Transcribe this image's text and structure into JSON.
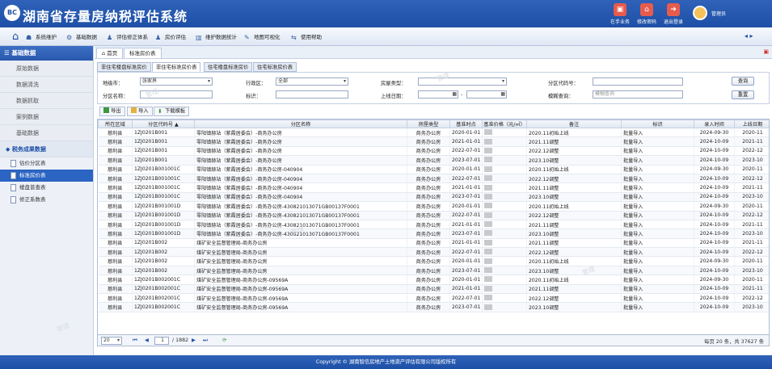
{
  "header": {
    "logo_text": "BC",
    "title": "湖南省存量房纳税评估系统",
    "buttons": [
      {
        "label": "在手业务",
        "icon": "briefcase-icon"
      },
      {
        "label": "修改密码",
        "icon": "lock-icon"
      },
      {
        "label": "退出登录",
        "icon": "logout-icon"
      }
    ],
    "user_name": "管理员"
  },
  "menu": [
    {
      "label": "系统维护",
      "icon": "users-icon"
    },
    {
      "label": "基础数据",
      "icon": "gear-icon"
    },
    {
      "label": "评估修正体系",
      "icon": "person-icon"
    },
    {
      "label": "房价评估",
      "icon": "person-icon"
    },
    {
      "label": "维护数据统计",
      "icon": "building-icon"
    },
    {
      "label": "地图可视化",
      "icon": "edit-icon"
    },
    {
      "label": "使用帮助",
      "icon": "help-icon"
    }
  ],
  "sidebar": {
    "title": "基础数据",
    "items": [
      "原始数据",
      "数据清洗",
      "数据抓取",
      "案例数据",
      "基础数据"
    ],
    "group": "税务成果数据",
    "subitems": [
      "估价分区表",
      "标准房价表",
      "楼盘普查表",
      "修正系数表"
    ]
  },
  "breadcrumb": {
    "home": "首页",
    "current": "标准房价表"
  },
  "subtabs": [
    "非住宅楼盘标准房价",
    "非住宅标准房价表",
    "住宅楼盘标准房价",
    "住宅标准房价表"
  ],
  "filters": {
    "city_label": "地级市：",
    "city_value": "张家界",
    "district_label": "行政区：",
    "district_value": "全部",
    "house_type_label": "房屋类型：",
    "house_type_value": "",
    "zone_code_label": "分区代码号：",
    "zone_code_value": "",
    "zone_name_label": "分区名称：",
    "zone_name_value": "",
    "mark_label": "标识：",
    "mark_value": "",
    "date_label": "上线日期：",
    "date_sep": "-",
    "fuzzy_label": "模糊查询：",
    "fuzzy_placeholder": "模糊查询",
    "search_button": "查询",
    "reset_button": "重置"
  },
  "toolbar": {
    "export": "导出",
    "import": "导入",
    "download": "下载模板"
  },
  "table": {
    "columns": [
      "所在区域",
      "分区代码号 ▲",
      "分区名称",
      "房屋类型",
      "基准时点",
      "基准价格（元/㎡）",
      "备注",
      "标识",
      "录入时间",
      "上线日期"
    ],
    "rows": [
      [
        "慈利县",
        "1ZJ0201B001",
        "零阳镇赫站（紫霞居委会）-商务办公房",
        "商务办公房",
        "2020-01-01",
        "",
        "2020.11初始上线",
        "批量导入",
        "2024-09-30",
        "2020-11"
      ],
      [
        "慈利县",
        "1ZJ0201B001",
        "零阳镇赫站（紫霞居委会）-商务办公房",
        "商务办公房",
        "2021-01-01",
        "",
        "2021.11调整",
        "批量导入",
        "2024-10-09",
        "2021-11"
      ],
      [
        "慈利县",
        "1ZJ0201B001",
        "零阳镇赫站（紫霞居委会）-商务办公房",
        "商务办公房",
        "2022-07-01",
        "",
        "2022.12调整",
        "批量导入",
        "2024-10-09",
        "2022-12"
      ],
      [
        "慈利县",
        "1ZJ0201B001",
        "零阳镇赫站（紫霞居委会）-商务办公房",
        "商务办公房",
        "2023-07-01",
        "",
        "2023.10调整",
        "批量导入",
        "2024-10-09",
        "2023-10"
      ],
      [
        "慈利县",
        "1ZJ0201B001001C",
        "零阳镇赫站（紫霞居委会）-商务办公房-040904",
        "商务办公房",
        "2020-01-01",
        "",
        "2020.11初始上线",
        "批量导入",
        "2024-09-30",
        "2020-11"
      ],
      [
        "慈利县",
        "1ZJ0201B001001C",
        "零阳镇赫站（紫霞居委会）-商务办公房-040904",
        "商务办公房",
        "2022-07-01",
        "",
        "2022.12调整",
        "批量导入",
        "2024-10-09",
        "2022-12"
      ],
      [
        "慈利县",
        "1ZJ0201B001001C",
        "零阳镇赫站（紫霞居委会）-商务办公房-040904",
        "商务办公房",
        "2021-01-01",
        "",
        "2021.11调整",
        "批量导入",
        "2024-10-09",
        "2021-11"
      ],
      [
        "慈利县",
        "1ZJ0201B001001C",
        "零阳镇赫站（紫霞居委会）-商务办公房-040904",
        "商务办公房",
        "2023-07-01",
        "",
        "2023.10调整",
        "批量导入",
        "2024-10-09",
        "2023-10"
      ],
      [
        "慈利县",
        "1ZJ0201B001001D",
        "零阳镇赫站（紫霞居委会）-商务办公房-430821013071GB00137F0001",
        "商务办公房",
        "2020-01-01",
        "",
        "2020.11初始上线",
        "批量导入",
        "2024-09-30",
        "2020-11"
      ],
      [
        "慈利县",
        "1ZJ0201B001001D",
        "零阳镇赫站（紫霞居委会）-商务办公房-430821013071GB00137F0001",
        "商务办公房",
        "2022-07-01",
        "",
        "2022.12调整",
        "批量导入",
        "2024-10-09",
        "2022-12"
      ],
      [
        "慈利县",
        "1ZJ0201B001001D",
        "零阳镇赫站（紫霞居委会）-商务办公房-430821013071GB00137F0001",
        "商务办公房",
        "2021-01-01",
        "",
        "2021.11调整",
        "批量导入",
        "2024-10-09",
        "2021-11"
      ],
      [
        "慈利县",
        "1ZJ0201B001001D",
        "零阳镇赫站（紫霞居委会）-商务办公房-430821013071GB00137F0001",
        "商务办公房",
        "2023-07-01",
        "",
        "2023.10调整",
        "批量导入",
        "2024-10-09",
        "2023-10"
      ],
      [
        "慈利县",
        "1ZJ0201B002",
        "煤矿安全监督管理局-商务办公房",
        "商务办公房",
        "2021-01-01",
        "",
        "2021.11调整",
        "批量导入",
        "2024-10-09",
        "2021-11"
      ],
      [
        "慈利县",
        "1ZJ0201B002",
        "煤矿安全监督管理局-商务办公房",
        "商务办公房",
        "2022-07-01",
        "",
        "2022.12调整",
        "批量导入",
        "2024-10-09",
        "2022-12"
      ],
      [
        "慈利县",
        "1ZJ0201B002",
        "煤矿安全监督管理局-商务办公房",
        "商务办公房",
        "2020-01-01",
        "",
        "2020.11初始上线",
        "批量导入",
        "2024-09-30",
        "2020-11"
      ],
      [
        "慈利县",
        "1ZJ0201B002",
        "煤矿安全监督管理局-商务办公房",
        "商务办公房",
        "2023-07-01",
        "",
        "2023.10调整",
        "批量导入",
        "2024-10-09",
        "2023-10"
      ],
      [
        "慈利县",
        "1ZJ0201B002001C",
        "煤矿安全监督管理局-商务办公房-09569A",
        "商务办公房",
        "2020-01-01",
        "",
        "2020.11初始上线",
        "批量导入",
        "2024-09-30",
        "2020-11"
      ],
      [
        "慈利县",
        "1ZJ0201B002001C",
        "煤矿安全监督管理局-商务办公房-09569A",
        "商务办公房",
        "2021-01-01",
        "",
        "2021.11调整",
        "批量导入",
        "2024-10-09",
        "2021-11"
      ],
      [
        "慈利县",
        "1ZJ0201B002001C",
        "煤矿安全监督管理局-商务办公房-09569A",
        "商务办公房",
        "2022-07-01",
        "",
        "2022.12调整",
        "批量导入",
        "2024-10-09",
        "2022-12"
      ],
      [
        "慈利县",
        "1ZJ0201B002001C",
        "煤矿安全监督管理局-商务办公房-09569A",
        "商务办公房",
        "2023-07-01",
        "",
        "2023.10调整",
        "批量导入",
        "2024-10-09",
        "2023-10"
      ]
    ]
  },
  "pager": {
    "page_size": "20",
    "current_page": "1",
    "total_pages": "/ 1882",
    "summary": "每页 20 条，共 37627 条"
  },
  "footer": {
    "copyright": "Copyright © 湖南智信房地产土地资产评估有限公司版权所有"
  },
  "watermark": "管理"
}
